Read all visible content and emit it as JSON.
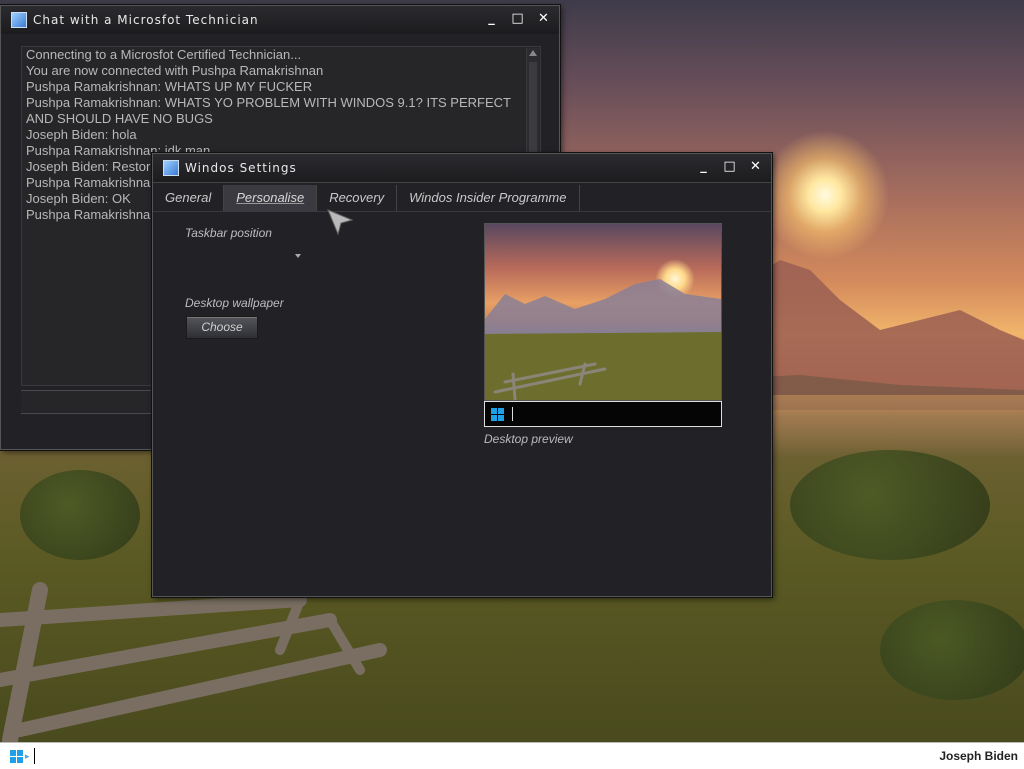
{
  "chat_window": {
    "title": "Chat with a Microsfot Technician",
    "messages": [
      "Connecting to a Microsfot Certified Technician...",
      "You are now connected with Pushpa Ramakrishnan",
      "Pushpa Ramakrishnan: WHATS UP MY FUCKER",
      "Pushpa Ramakrishnan: WHATS YO PROBLEM WITH WINDOS 9.1? ITS PERFECT AND SHOULD HAVE NO BUGS",
      "Joseph Biden: hola",
      "Pushpa Ramakrishnan: idk man",
      "Joseph Biden: Restor",
      "Pushpa Ramakrishna",
      "Joseph Biden: OK",
      "Pushpa Ramakrishna"
    ],
    "input_value": ""
  },
  "settings_window": {
    "title": "Windos Settings",
    "tabs": [
      "General",
      "Personalise",
      "Recovery",
      "Windos Insider Programme"
    ],
    "active_tab": "Personalise",
    "taskbar_position_label": "Taskbar position",
    "desktop_wallpaper_label": "Desktop wallpaper",
    "choose_button": "Choose",
    "preview_caption": "Desktop preview"
  },
  "window_controls": {
    "minimize": "_",
    "maximize": "□",
    "close": "✕"
  },
  "taskbar": {
    "user": "Joseph Biden"
  },
  "colors": {
    "accent": "#1fa0e6",
    "window_bg": "#222226",
    "titlebar": "#1c1c1f"
  }
}
